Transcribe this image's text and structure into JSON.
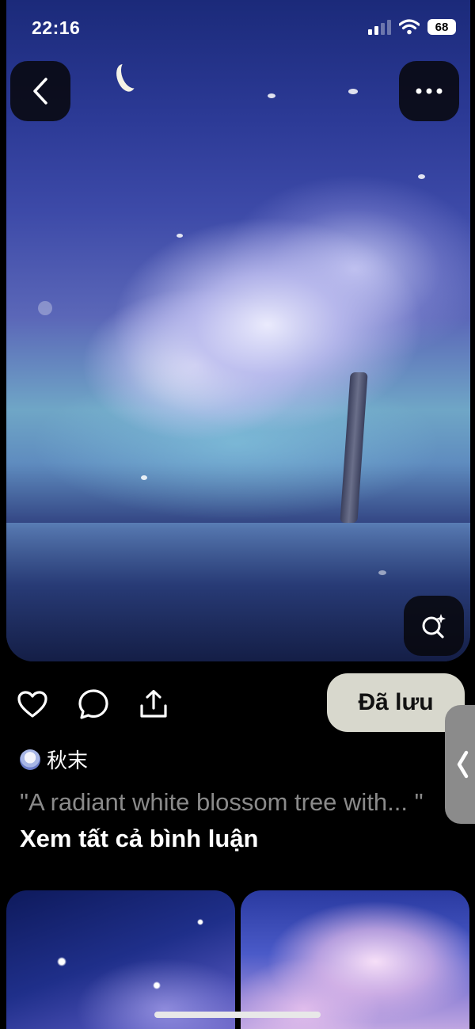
{
  "status_bar": {
    "time": "22:16",
    "battery": "68",
    "icons": [
      "signal-icon",
      "wifi-icon",
      "battery-icon"
    ]
  },
  "hero": {
    "buttons": {
      "back": "back-icon",
      "more": "more-icon",
      "visual_search": "visual-search-icon"
    }
  },
  "actions": {
    "icons": [
      "heart-icon",
      "comment-icon",
      "share-icon"
    ],
    "saved_label": "Đã lưu"
  },
  "author": {
    "name": "秋末"
  },
  "description": {
    "quote": "\"A radiant white blossom tree with... \"",
    "see_all": "Xem tất cả bình luận"
  },
  "colors": {
    "background": "#000000",
    "saved_button": "#d8d8cd",
    "muted_text": "#8a8a8a"
  }
}
